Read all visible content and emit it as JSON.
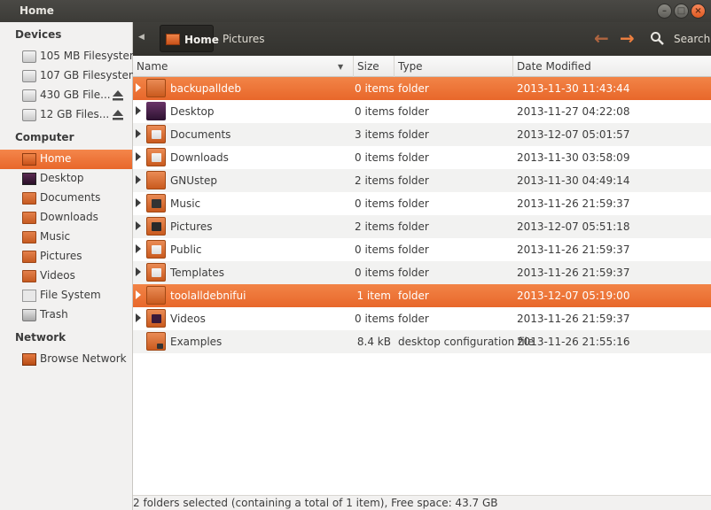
{
  "window": {
    "title": "Home"
  },
  "sidebar": {
    "sections": [
      {
        "heading": "Devices",
        "items": [
          {
            "label": "105 MB Filesystem",
            "icon": "drive-icon",
            "eject": false
          },
          {
            "label": "107 GB Filesystem",
            "icon": "drive-icon",
            "eject": false
          },
          {
            "label": "430 GB File...",
            "icon": "drive-icon",
            "eject": true
          },
          {
            "label": "12 GB Files...",
            "icon": "drive-icon",
            "eject": true
          }
        ]
      },
      {
        "heading": "Computer",
        "items": [
          {
            "label": "Home",
            "icon": "home-folder-icon",
            "selected": true
          },
          {
            "label": "Desktop",
            "icon": "desktop-icon"
          },
          {
            "label": "Documents",
            "icon": "documents-folder-icon"
          },
          {
            "label": "Downloads",
            "icon": "downloads-folder-icon"
          },
          {
            "label": "Music",
            "icon": "music-folder-icon"
          },
          {
            "label": "Pictures",
            "icon": "pictures-folder-icon"
          },
          {
            "label": "Videos",
            "icon": "videos-folder-icon"
          },
          {
            "label": "File System",
            "icon": "filesystem-icon"
          },
          {
            "label": "Trash",
            "icon": "trash-icon"
          }
        ]
      },
      {
        "heading": "Network",
        "items": [
          {
            "label": "Browse Network",
            "icon": "network-icon"
          }
        ]
      }
    ]
  },
  "toolbar": {
    "breadcrumbs": [
      "Home",
      "Pictures"
    ],
    "search_label": "Search"
  },
  "columns": [
    "Name",
    "Size",
    "Type",
    "Date Modified"
  ],
  "rows": [
    {
      "name": "backupalldeb",
      "size": "0 items",
      "type": "folder",
      "date": "2013-11-30 11:43:44",
      "selected": true,
      "icon": "folder-icon"
    },
    {
      "name": "Desktop",
      "size": "0 items",
      "type": "folder",
      "date": "2013-11-27 04:22:08",
      "icon": "desktop-folder-icon"
    },
    {
      "name": "Documents",
      "size": "3 items",
      "type": "folder",
      "date": "2013-12-07 05:01:57",
      "icon": "documents-folder-icon"
    },
    {
      "name": "Downloads",
      "size": "0 items",
      "type": "folder",
      "date": "2013-11-30 03:58:09",
      "icon": "downloads-folder-icon"
    },
    {
      "name": "GNUstep",
      "size": "2 items",
      "type": "folder",
      "date": "2013-11-30 04:49:14",
      "icon": "folder-icon"
    },
    {
      "name": "Music",
      "size": "0 items",
      "type": "folder",
      "date": "2013-11-26 21:59:37",
      "icon": "music-folder-icon"
    },
    {
      "name": "Pictures",
      "size": "2 items",
      "type": "folder",
      "date": "2013-12-07 05:51:18",
      "icon": "pictures-folder-icon"
    },
    {
      "name": "Public",
      "size": "0 items",
      "type": "folder",
      "date": "2013-11-26 21:59:37",
      "icon": "public-folder-icon"
    },
    {
      "name": "Templates",
      "size": "0 items",
      "type": "folder",
      "date": "2013-11-26 21:59:37",
      "icon": "templates-folder-icon"
    },
    {
      "name": "toolalldebnifui",
      "size": "1 item",
      "type": "folder",
      "date": "2013-12-07 05:19:00",
      "selected": true,
      "icon": "folder-icon"
    },
    {
      "name": "Videos",
      "size": "0 items",
      "type": "folder",
      "date": "2013-11-26 21:59:37",
      "icon": "videos-folder-icon"
    },
    {
      "name": "Examples",
      "size": "8.4 kB",
      "type": "desktop configuration file",
      "date": "2013-11-26 21:55:16",
      "icon": "examples-link-icon",
      "leaf": true
    }
  ],
  "status": {
    "text": "2 folders selected (containing a total of 1 item), Free space: 43.7 GB"
  },
  "colors": {
    "accent": "#e8672a",
    "toolbar": "#3c3b37",
    "sidebar": "#f2f1f0"
  }
}
